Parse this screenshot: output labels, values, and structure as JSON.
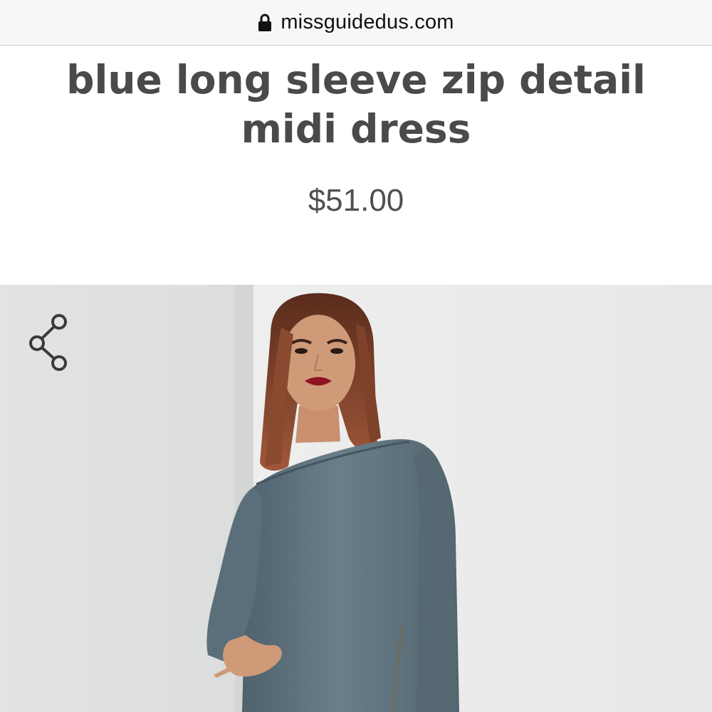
{
  "browser": {
    "url": "missguidedus.com",
    "lock_icon": "lock-icon"
  },
  "product": {
    "title": "blue long sleeve zip detail midi dress",
    "price": "$51.00",
    "share_icon": "share-icon"
  },
  "colors": {
    "title_text": "#4a4a4a",
    "dress": "#5f7480",
    "background": "#e9e9e9"
  }
}
